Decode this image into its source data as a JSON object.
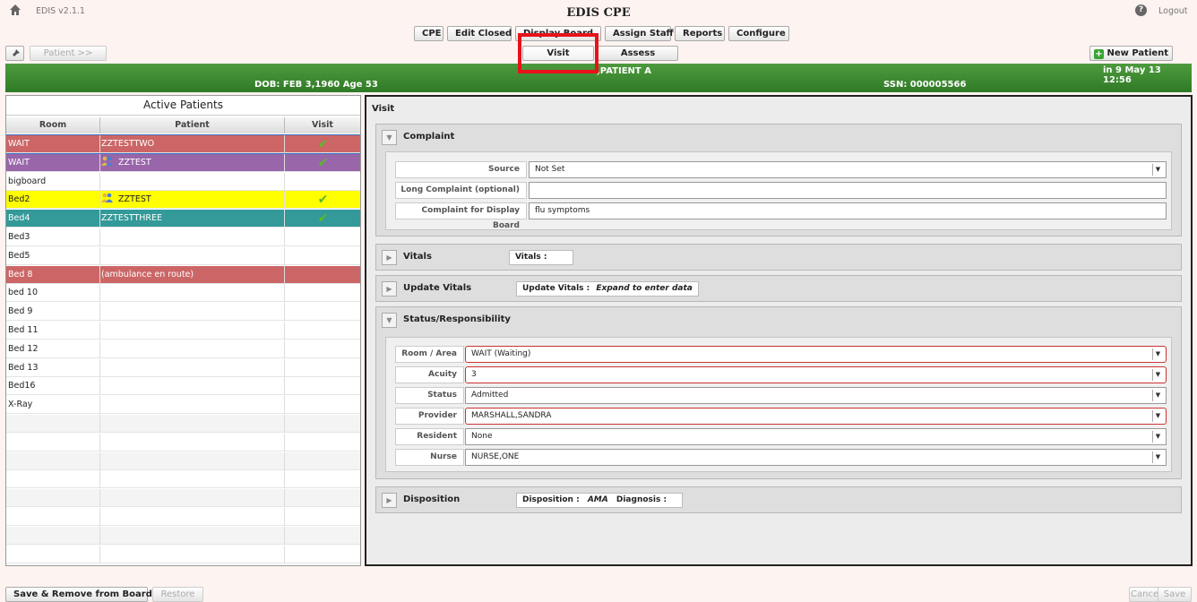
{
  "app": {
    "version": "EDIS v2.1.1",
    "title": "EDIS CPE",
    "logout": "Logout",
    "help": "?",
    "home_icon": "home-icon"
  },
  "nav": {
    "tabs": [
      "CPE",
      "Edit Closed",
      "Display Board",
      "Assign Staff",
      "Reports",
      "Configure"
    ],
    "subtabs": [
      "Visit",
      "Assess"
    ],
    "pin_icon": "pin-icon",
    "patient_button": "Patient >>",
    "new_patient_button": "New Patient"
  },
  "patient_banner": {
    "name": ",PATIENT A",
    "dob_age": "DOB: FEB 3,1960  Age 53",
    "ssn": "SSN: 000005566",
    "datetime": "in 9 May 13 12:56"
  },
  "active_patients": {
    "title": "Active Patients",
    "columns": [
      "Room",
      "Patient",
      "Visit"
    ],
    "rows": [
      {
        "room": "WAIT",
        "patient": "ZZTESTTWO",
        "visit": "✔",
        "bg": "#cc6666",
        "fg": "#ffffff",
        "icon": ""
      },
      {
        "room": "WAIT",
        "patient": "ZZTEST",
        "visit": "✔",
        "bg": "#9966aa",
        "fg": "#ffffff",
        "icon": "people-icon"
      },
      {
        "room": "bigboard",
        "patient": "",
        "visit": "",
        "bg": "#ffffff",
        "fg": "#222222",
        "icon": ""
      },
      {
        "room": "Bed2",
        "patient": "ZZTEST",
        "visit": "✔",
        "bg": "#ffff00",
        "fg": "#222222",
        "icon": "people-icon"
      },
      {
        "room": "Bed4",
        "patient": "ZZTESTTHREE",
        "visit": "✔",
        "bg": "#339999",
        "fg": "#ffffff",
        "icon": ""
      },
      {
        "room": "Bed3",
        "patient": "",
        "visit": "",
        "bg": "#ffffff",
        "fg": "#222222",
        "icon": ""
      },
      {
        "room": "Bed5",
        "patient": "",
        "visit": "",
        "bg": "#ffffff",
        "fg": "#222222",
        "icon": ""
      },
      {
        "room": "Bed 8",
        "patient": "(ambulance en route)",
        "visit": "",
        "bg": "#cc6666",
        "fg": "#ffffff",
        "icon": ""
      },
      {
        "room": "bed 10",
        "patient": "",
        "visit": "",
        "bg": "#ffffff",
        "fg": "#222222",
        "icon": ""
      },
      {
        "room": "Bed 9",
        "patient": "",
        "visit": "",
        "bg": "#ffffff",
        "fg": "#222222",
        "icon": ""
      },
      {
        "room": "Bed 11",
        "patient": "",
        "visit": "",
        "bg": "#ffffff",
        "fg": "#222222",
        "icon": ""
      },
      {
        "room": "Bed 12",
        "patient": "",
        "visit": "",
        "bg": "#ffffff",
        "fg": "#222222",
        "icon": ""
      },
      {
        "room": "Bed 13",
        "patient": "",
        "visit": "",
        "bg": "#ffffff",
        "fg": "#222222",
        "icon": ""
      },
      {
        "room": "Bed16",
        "patient": "",
        "visit": "",
        "bg": "#ffffff",
        "fg": "#222222",
        "icon": ""
      },
      {
        "room": "X-Ray",
        "patient": "",
        "visit": "",
        "bg": "#ffffff",
        "fg": "#222222",
        "icon": ""
      }
    ]
  },
  "visit": {
    "title": "Visit",
    "complaint": {
      "title": "Complaint",
      "source_label": "Source",
      "source_value": "Not Set",
      "long_label": "Long Complaint (optional)",
      "long_value": "",
      "display_label": "Complaint for Display Board",
      "display_value": "flu symptoms"
    },
    "vitals": {
      "title": "Vitals",
      "summary_label": "Vitals :"
    },
    "update_vitals": {
      "title": "Update Vitals",
      "summary_label": "Update Vitals :",
      "summary_value": "Expand to enter data"
    },
    "status": {
      "title": "Status/Responsibility",
      "room_label": "Room / Area",
      "room_value": "WAIT  (Waiting)",
      "acuity_label": "Acuity",
      "acuity_value": "3",
      "status_label": "Status",
      "status_value": "Admitted",
      "provider_label": "Provider",
      "provider_value": "MARSHALL,SANDRA",
      "resident_label": "Resident",
      "resident_value": "None",
      "nurse_label": "Nurse",
      "nurse_value": "NURSE,ONE"
    },
    "disposition": {
      "title": "Disposition",
      "disp_label": "Disposition :",
      "disp_value": "AMA",
      "diag_label": "Diagnosis :"
    }
  },
  "footer": {
    "save_remove": "Save & Remove from Board",
    "restore": "Restore",
    "cancel": "Cancel",
    "save": "Save"
  }
}
